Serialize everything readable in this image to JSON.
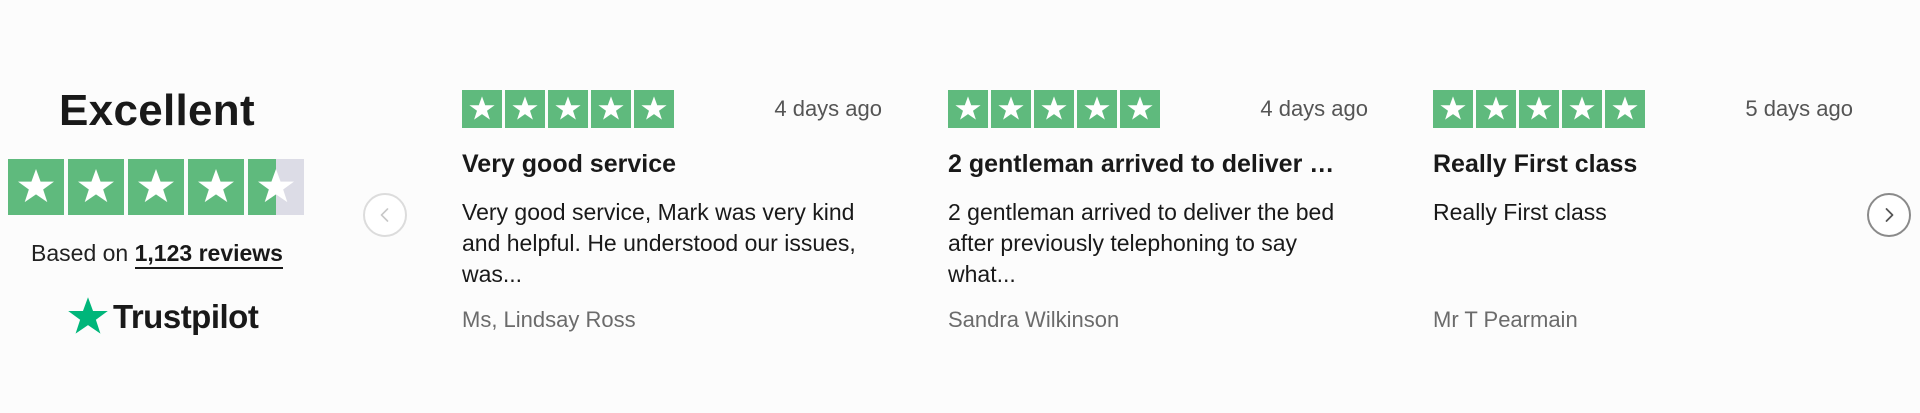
{
  "summary": {
    "rating_word": "Excellent",
    "based_on_prefix": "Based on",
    "review_count_link": "1,123 reviews",
    "brand_name": "Trustpilot",
    "stars": [
      {
        "fill": 1
      },
      {
        "fill": 1
      },
      {
        "fill": 1
      },
      {
        "fill": 1
      },
      {
        "fill": 0.5
      }
    ]
  },
  "colors": {
    "star_green": "#5fba7d",
    "star_empty": "#dcdce6",
    "brand_green": "#00b67a"
  },
  "navigation": {
    "prev_icon": "chevron-left-icon",
    "next_icon": "chevron-right-icon"
  },
  "reviews": [
    {
      "stars": 5,
      "date": "4 days ago",
      "title": "Very good service",
      "body": "Very good service, Mark was very kind and helpful. He understood our issues, was...",
      "author": "Ms, Lindsay Ross"
    },
    {
      "stars": 5,
      "date": "4 days ago",
      "title": "2 gentleman arrived to deliver …",
      "body": "2 gentleman arrived to deliver the bed after previously telephoning to say what...",
      "author": "Sandra Wilkinson"
    },
    {
      "stars": 5,
      "date": "5 days ago",
      "title": "Really First class",
      "body": "Really First class",
      "author": "Mr T Pearmain"
    }
  ]
}
